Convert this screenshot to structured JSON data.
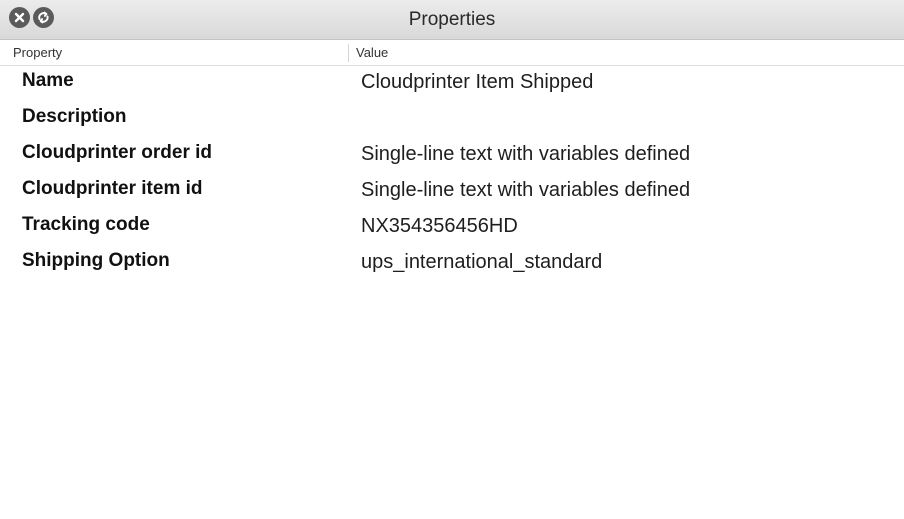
{
  "window": {
    "title": "Properties",
    "controls": [
      "close-icon",
      "restore-icon"
    ]
  },
  "table": {
    "columns": {
      "property": "Property",
      "value": "Value"
    },
    "rows": [
      {
        "property": "Name",
        "value": "Cloudprinter Item Shipped"
      },
      {
        "property": "Description",
        "value": ""
      },
      {
        "property": "Cloudprinter order id",
        "value": "Single-line text with variables defined"
      },
      {
        "property": "Cloudprinter item id",
        "value": "Single-line text with variables defined"
      },
      {
        "property": "Tracking code",
        "value": "NX354356456HD"
      },
      {
        "property": "Shipping Option",
        "value": "ups_international_standard"
      }
    ]
  }
}
